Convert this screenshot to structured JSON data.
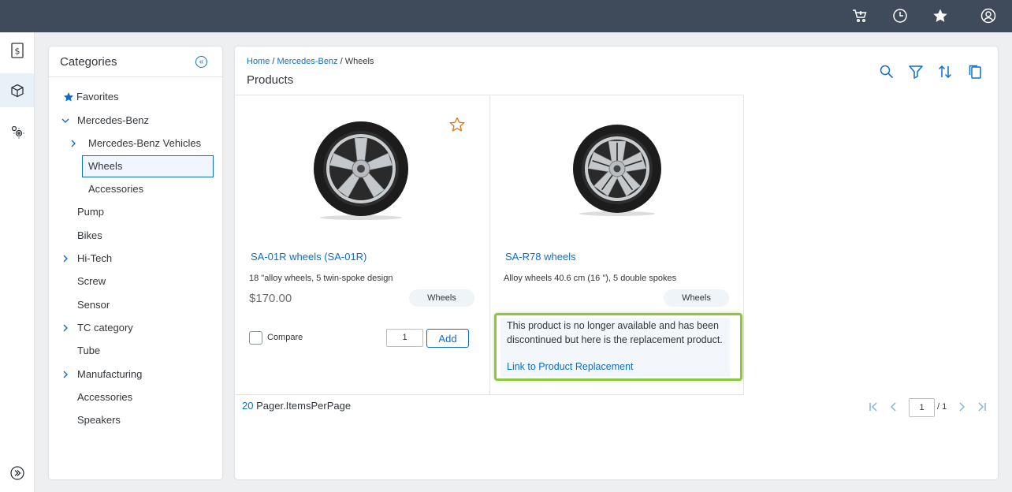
{
  "topbar": {
    "icons": [
      "cart-icon",
      "history-icon",
      "star-icon",
      "user-icon"
    ]
  },
  "leftrail": {
    "items": [
      "dollar-document-icon",
      "product-box-icon",
      "settings-icon"
    ],
    "expand_icon": "expand-icon"
  },
  "categories": {
    "title": "Categories",
    "items": [
      {
        "label": "Favorites"
      },
      {
        "label": "Mercedes-Benz"
      },
      {
        "label": "Mercedes-Benz Vehicles"
      },
      {
        "label": "Wheels"
      },
      {
        "label": "Accessories"
      },
      {
        "label": "Pump"
      },
      {
        "label": "Bikes"
      },
      {
        "label": "Hi-Tech"
      },
      {
        "label": "Screw"
      },
      {
        "label": "Sensor"
      },
      {
        "label": "TC category"
      },
      {
        "label": "Tube"
      },
      {
        "label": "Manufacturing"
      },
      {
        "label": "Accessories"
      },
      {
        "label": "Speakers"
      }
    ]
  },
  "main": {
    "breadcrumb": {
      "home": "Home",
      "sep1": " / ",
      "brand": "Mercedes-Benz",
      "sep2": " / ",
      "current": "Wheels"
    },
    "title": "Products",
    "products": [
      {
        "name": "SA-01R wheels (SA-01R)",
        "description": "18 \"alloy wheels, 5 twin-spoke design",
        "price": "$170.00",
        "tag": "Wheels",
        "compare_label": "Compare",
        "quantity": "1",
        "add_label": "Add"
      },
      {
        "name": "SA-R78 wheels",
        "description": "Alloy wheels 40.6 cm (16 \"), 5 double spokes",
        "tag": "Wheels",
        "notice_text": "This product is no longer available and has been discontinued but here is the replacement product.",
        "notice_link": "Link to Product Replacement"
      }
    ],
    "pager": {
      "items_per_page": "20",
      "items_label": "Pager.ItemsPerPage",
      "current_page": "1",
      "total_pages": "/ 1"
    }
  },
  "colors": {
    "shell": "#3f4b5b",
    "accent": "#0a6ed1",
    "highlight": "#8ec641",
    "favorite": "#e9730c"
  }
}
